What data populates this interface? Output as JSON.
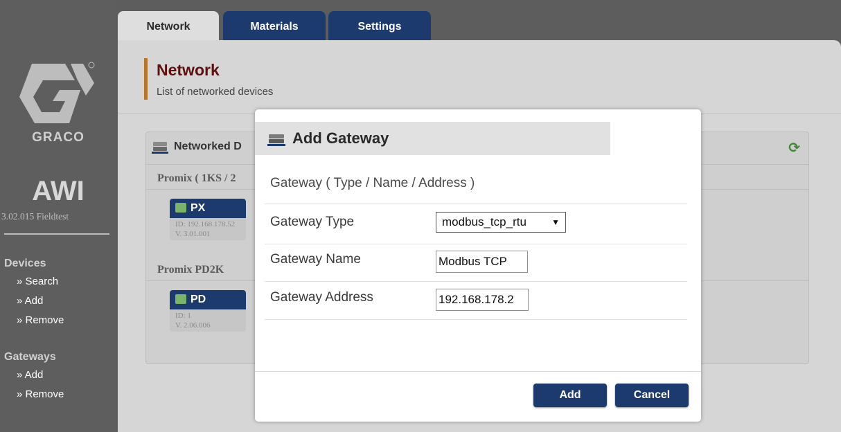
{
  "sidebar": {
    "brand": "GRACO",
    "app": "AWI",
    "version": "3.02.015 Fieldtest",
    "devices_heading": "Devices",
    "devices_links": [
      "» Search",
      "» Add",
      "» Remove"
    ],
    "gateways_heading": "Gateways",
    "gateways_links": [
      "» Add",
      "» Remove"
    ]
  },
  "tabs": [
    "Network",
    "Materials",
    "Settings"
  ],
  "page": {
    "title": "Network",
    "subtitle": "List of networked devices"
  },
  "devices_box": {
    "title": "Networked D",
    "groups": [
      {
        "title": "Promix ( 1KS / 2",
        "device": {
          "name": "PX",
          "id": "ID: 192.168.178.52",
          "version": "V. 3.01.001"
        }
      },
      {
        "title": "Promix PD2K",
        "device": {
          "name": "PD",
          "id": "ID: 1",
          "version": "V. 2.06.006"
        }
      }
    ]
  },
  "modal": {
    "title": "Add Gateway",
    "section": "Gateway ( Type / Name / Address )",
    "type_label": "Gateway Type",
    "type_value": "modbus_tcp_rtu",
    "name_label": "Gateway Name",
    "name_value": "Modbus TCP",
    "address_label": "Gateway Address",
    "address_value": "192.168.178.2",
    "add_label": "Add",
    "cancel_label": "Cancel"
  },
  "colors": {
    "navy": "#1c3a6e",
    "title_red": "#5e1010",
    "accent": "#b6762a",
    "refresh_green": "#3d8a32"
  }
}
